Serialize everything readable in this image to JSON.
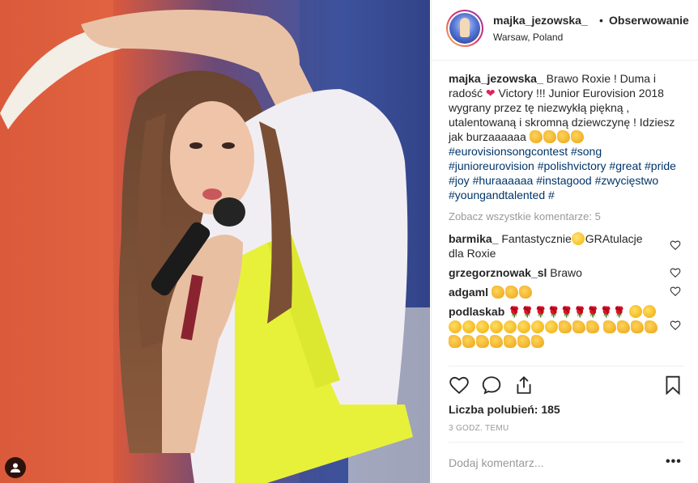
{
  "post": {
    "username": "majka_jezowska_",
    "bullet": "•",
    "follow_label": "Obserwowanie",
    "location": "Warsaw, Poland"
  },
  "caption": {
    "username": "majka_jezowska_",
    "text_1": "Brawo Roxie ! Duma i radość",
    "text_2": "Victory !!! Junior Eurovision 2018 wygrany przez tę niezwykłą piękną , utalentowaną i skromną dziewczynę ! Idziesz jak burzaaaaaa",
    "hashtags": "#eurovisionsongcontest #song #junioreurovision #polishvictory #great #pride #joy #huraaaaaa #instagood #zwycięstwo #youngandtalented #"
  },
  "view_all_comments": "Zobacz wszystkie komentarze: 5",
  "comments": [
    {
      "username": "barmika_",
      "text_1": "Fantastycznie",
      "text_2": "GRAtulacje dla Roxie"
    },
    {
      "username": "grzegorznowak_sl",
      "text": "Brawo"
    },
    {
      "username": "adgaml",
      "text": ""
    },
    {
      "username": "podlaskab",
      "text": ""
    }
  ],
  "likes_label": "Liczba polubień: 185",
  "timestamp": "3 GODZ. TEMU",
  "add_comment_placeholder": "Dodaj komentarz...",
  "more_label": "•••",
  "icons": {
    "like": "heart-icon",
    "comment": "comment-icon",
    "share": "share-icon",
    "save": "bookmark-icon",
    "tag": "user-tag-icon"
  },
  "colors": {
    "hashtag": "#003569",
    "muted": "#999999",
    "text": "#262626",
    "heart_emoji": "#e0245e"
  }
}
